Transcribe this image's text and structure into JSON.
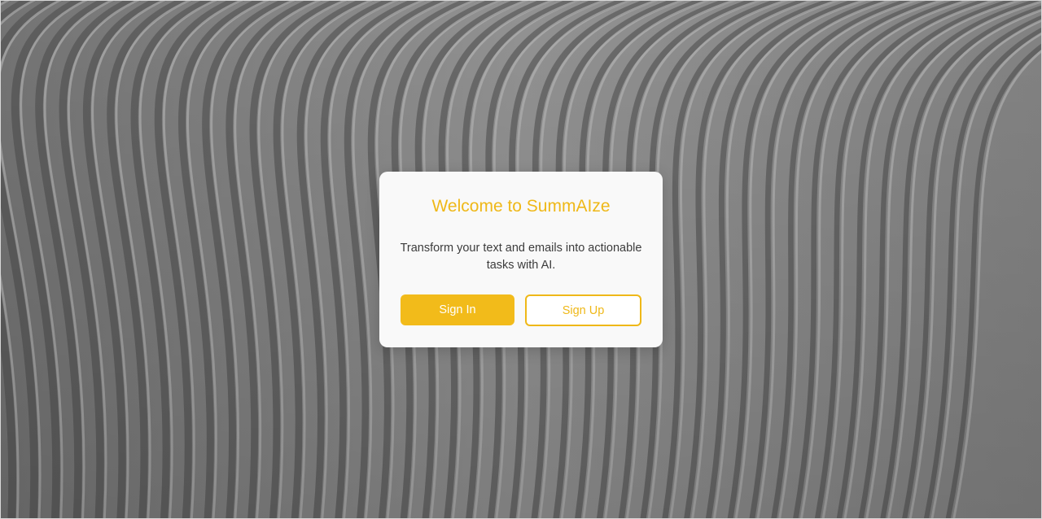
{
  "background": {
    "description_icon": "architectural-ribs-image",
    "base_color": "#8f8f8f"
  },
  "dialog": {
    "title": "Welcome to SummAIze",
    "description": "Transform your text and emails into actionable tasks with AI.",
    "sign_in_label": "Sign In",
    "sign_up_label": "Sign Up"
  },
  "colors": {
    "accent": "#efb818",
    "button_fill": "#f2bb1a",
    "card_bg": "#f9f9f9",
    "text": "#3c3c3c"
  }
}
